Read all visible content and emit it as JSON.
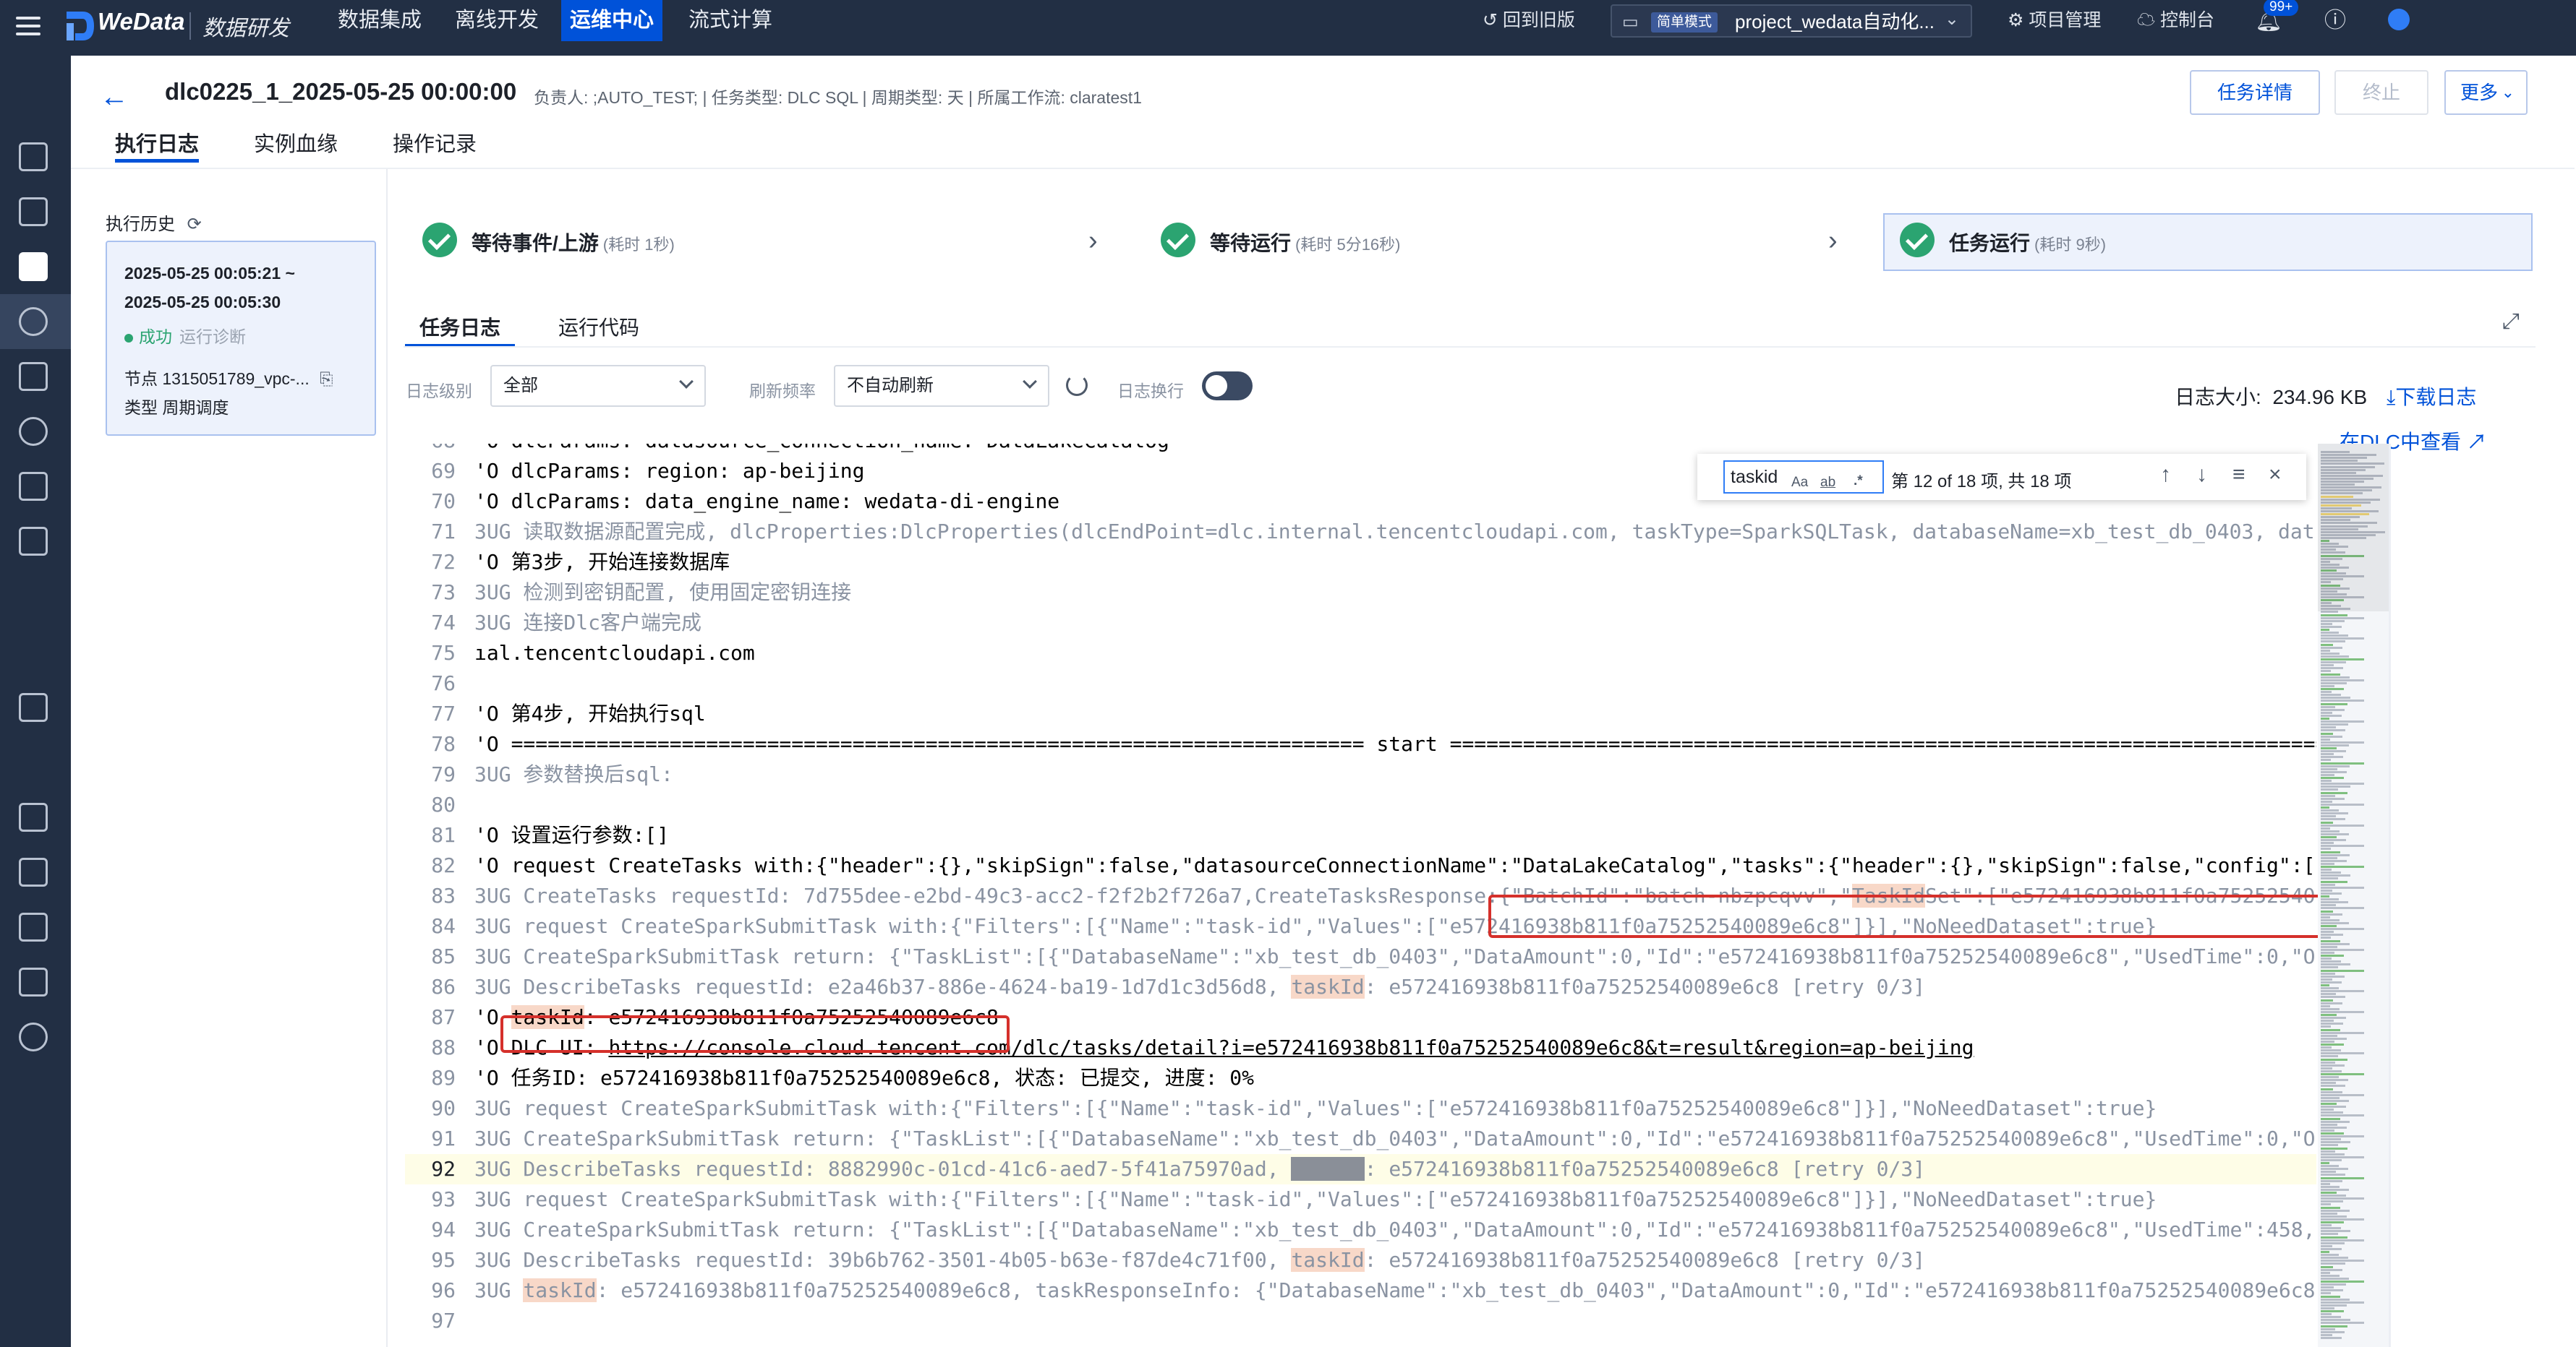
{
  "topbar": {
    "brand": "WeData",
    "brand_sub": "数据研发",
    "nav": [
      "数据集成",
      "离线开发",
      "运维中心",
      "流式计算"
    ],
    "active_nav": "运维中心",
    "back_old": "回到旧版",
    "mode_tag": "简单模式",
    "project": "project_wedata自动化...",
    "project_mgmt": "项目管理",
    "console": "控制台",
    "notif_count": "99+"
  },
  "header": {
    "title": "dlc0225_1_2025-05-25 00:00:00",
    "meta": "负责人: ;AUTO_TEST;  |  任务类型: DLC SQL  |  周期类型: 天  |  所属工作流: claratest1",
    "btn_detail": "任务详情",
    "btn_stop": "终止",
    "btn_more": "更多",
    "tabs": [
      "执行日志",
      "实例血缘",
      "操作记录"
    ]
  },
  "history": {
    "label": "执行历史",
    "start": "2025-05-25 00:05:21 ~",
    "end": "2025-05-25 00:05:30",
    "status": "成功",
    "diag": "运行诊断",
    "node": "节点 1315051789_vpc-...",
    "type": "类型 周期调度"
  },
  "steps": [
    {
      "label": "等待事件/上游",
      "dur": "(耗时 1秒)"
    },
    {
      "label": "等待运行",
      "dur": "(耗时 5分16秒)"
    },
    {
      "label": "任务运行",
      "dur": "(耗时 9秒)"
    }
  ],
  "log": {
    "tabs": [
      "任务日志",
      "运行代码"
    ],
    "level_label": "日志级别",
    "level_value": "全部",
    "freq_label": "刷新频率",
    "freq_value": "不自动刷新",
    "wrap_label": "日志换行",
    "size_label": "日志大小:",
    "size_value": "234.96 KB",
    "download": "下载日志",
    "view_dlc": "在DLC中查看"
  },
  "find": {
    "query": "taskid",
    "opt_case": "Aa",
    "opt_word": "ab",
    "opt_regex": ".*",
    "count": "第 12 of 18 项, 共 18 项"
  },
  "code_lines": [
    {
      "n": "68",
      "t": "info",
      "c": "'O dlcParams: datasource_connection_name: DataLakeCatalog"
    },
    {
      "n": "69",
      "t": "info",
      "c": "'O dlcParams: region: ap-beijing"
    },
    {
      "n": "70",
      "t": "info",
      "c": "'O dlcParams: data_engine_name: wedata-di-engine"
    },
    {
      "n": "71",
      "t": "dbg",
      "c": "3UG 读取数据源配置完成, dlcProperties:DlcProperties(dlcEndPoint=dlc.internal.tencentcloudapi.com, taskType=SparkSQLTask, databaseName=xb_test_db_0403, dat"
    },
    {
      "n": "72",
      "t": "info",
      "c": "'O 第3步, 开始连接数据库"
    },
    {
      "n": "73",
      "t": "dbg",
      "c": "3UG 检测到密钥配置, 使用固定密钥连接"
    },
    {
      "n": "74",
      "t": "dbg",
      "c": "3UG 连接Dlc客户端完成"
    },
    {
      "n": "75",
      "t": "info",
      "c": "ıal.tencentcloudapi.com"
    },
    {
      "n": "76",
      "t": "info",
      "c": ""
    },
    {
      "n": "77",
      "t": "info",
      "c": "'O 第4步, 开始执行sql"
    },
    {
      "n": "78",
      "t": "info",
      "c": "'O ====================================================================== start ========================================================================"
    },
    {
      "n": "79",
      "t": "dbg",
      "c": "3UG 参数替换后sql:"
    },
    {
      "n": "80",
      "t": "info",
      "c": ""
    },
    {
      "n": "81",
      "t": "info",
      "c": "'O 设置运行参数:[]"
    },
    {
      "n": "82",
      "t": "info",
      "c": "'O request CreateTasks with:{\"header\":{},\"skipSign\":false,\"datasourceConnectionName\":\"DataLakeCatalog\",\"tasks\":{\"header\":{},\"skipSign\":false,\"config\":["
    },
    {
      "n": "83",
      "t": "dbg",
      "c": "3UG CreateTasks requestId: 7d755dee-e2bd-49c3-acc2-f2f2b2f726a7,CreateTasksResponse:{\"BatchId\":\"batch-nbzpcqvv\",\"",
      "m": "TaskId",
      "c2": "Set\":[\"e572416938b811f0a75252540"
    },
    {
      "n": "84",
      "t": "dbg",
      "c": "3UG request CreateSparkSubmitTask with:{\"Filters\":[{\"Name\":\"task-id\",\"Values\":[\"e572416938b811f0a75252540089e6c8\"]}],\"NoNeedDataset\":true}"
    },
    {
      "n": "85",
      "t": "dbg",
      "c": "3UG CreateSparkSubmitTask return: {\"TaskList\":[{\"DatabaseName\":\"xb_test_db_0403\",\"DataAmount\":0,\"Id\":\"e572416938b811f0a75252540089e6c8\",\"UsedTime\":0,\"O"
    },
    {
      "n": "86",
      "t": "dbg",
      "c": "3UG DescribeTasks requestId: e2a46b37-886e-4624-ba19-1d7d1c3d56d8, ",
      "m": "taskId",
      "c2": ": e572416938b811f0a75252540089e6c8 [retry 0/3]"
    },
    {
      "n": "87",
      "t": "info",
      "c": "'O ",
      "m": "taskId",
      "c2": ": e572416938b811f0a75252540089e6c8"
    },
    {
      "n": "88",
      "t": "info",
      "c": "'O DLC UI: ",
      "u": "https://console.cloud.tencent.com/dlc/tasks/detail?i=e572416938b811f0a75252540089e6c8&t=result&region=ap-beijing"
    },
    {
      "n": "89",
      "t": "info",
      "c": "'O 任务ID: e572416938b811f0a75252540089e6c8, 状态: 已提交, 进度: 0%"
    },
    {
      "n": "90",
      "t": "dbg",
      "c": "3UG request CreateSparkSubmitTask with:{\"Filters\":[{\"Name\":\"task-id\",\"Values\":[\"e572416938b811f0a75252540089e6c8\"]}],\"NoNeedDataset\":true}"
    },
    {
      "n": "91",
      "t": "dbg",
      "c": "3UG CreateSparkSubmitTask return: {\"TaskList\":[{\"DatabaseName\":\"xb_test_db_0403\",\"DataAmount\":0,\"Id\":\"e572416938b811f0a75252540089e6c8\",\"UsedTime\":0,\"O"
    },
    {
      "n": "92",
      "t": "dbg",
      "hl": true,
      "c": "3UG DescribeTasks requestId: 8882990c-01cd-41c6-aed7-5f41a75970ad, ",
      "mc": "taskId",
      "c2": ": e572416938b811f0a75252540089e6c8 [retry 0/3]"
    },
    {
      "n": "93",
      "t": "dbg",
      "c": "3UG request CreateSparkSubmitTask with:{\"Filters\":[{\"Name\":\"task-id\",\"Values\":[\"e572416938b811f0a75252540089e6c8\"]}],\"NoNeedDataset\":true}"
    },
    {
      "n": "94",
      "t": "dbg",
      "c": "3UG CreateSparkSubmitTask return: {\"TaskList\":[{\"DatabaseName\":\"xb_test_db_0403\",\"DataAmount\":0,\"Id\":\"e572416938b811f0a75252540089e6c8\",\"UsedTime\":458,"
    },
    {
      "n": "95",
      "t": "dbg",
      "c": "3UG DescribeTasks requestId: 39b6b762-3501-4b05-b63e-f87de4c71f00, ",
      "m": "taskId",
      "c2": ": e572416938b811f0a75252540089e6c8 [retry 0/3]"
    },
    {
      "n": "96",
      "t": "dbg",
      "c": "3UG ",
      "m": "taskId",
      "c2": ": e572416938b811f0a75252540089e6c8, taskResponseInfo: {\"DatabaseName\":\"xb_test_db_0403\",\"DataAmount\":0,\"Id\":\"e572416938b811f0a75252540089e6c8"
    },
    {
      "n": "97",
      "t": "info",
      "c": ""
    }
  ]
}
